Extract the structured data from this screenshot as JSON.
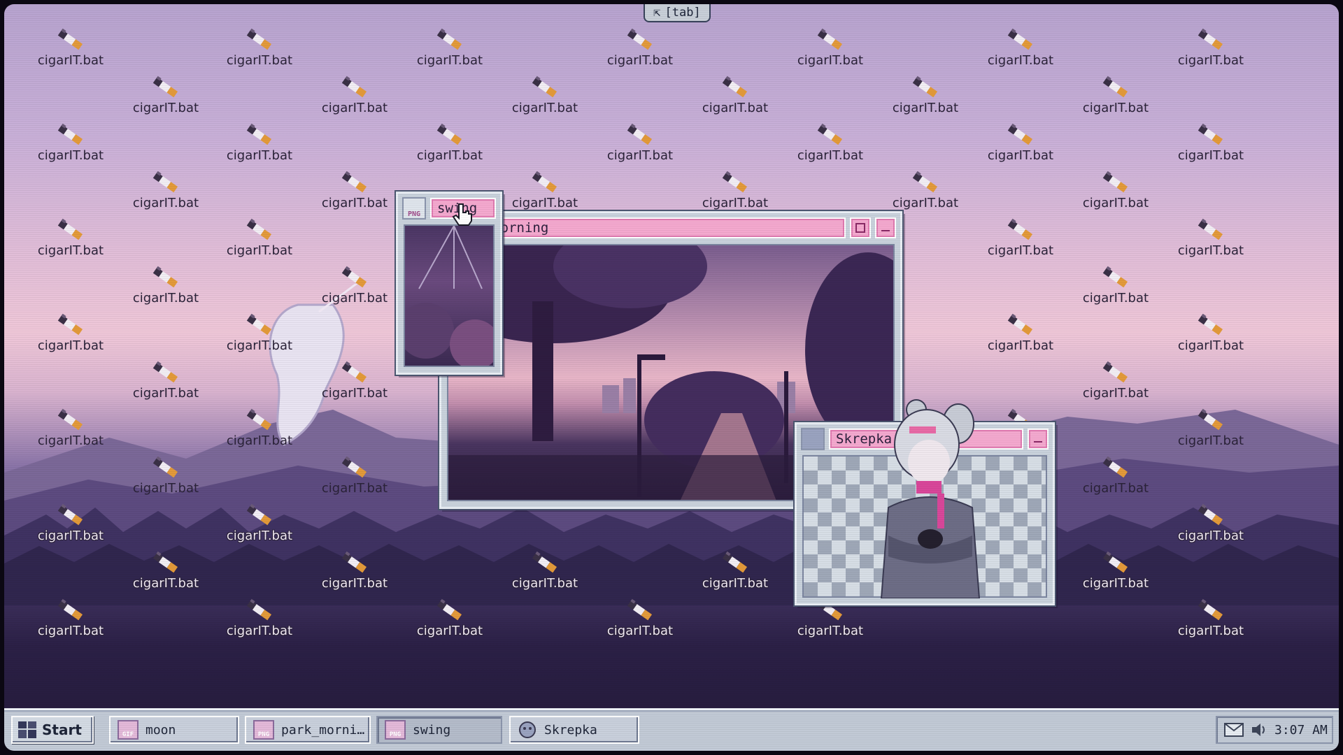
{
  "tab_hint": {
    "label": "[tab]"
  },
  "desktop": {
    "icon_name": "cigarette-icon",
    "icon_label": "cigarIT.bat"
  },
  "windows": {
    "swing": {
      "title": "swing",
      "file_badge": "PNG"
    },
    "park": {
      "title": "park_morning"
    },
    "skrepka": {
      "title": "Skrepka"
    }
  },
  "taskbar": {
    "start_label": "Start",
    "items": [
      {
        "label": "moon",
        "badge": "GIF"
      },
      {
        "label": "park_morni…",
        "badge": "PNG"
      },
      {
        "label": "swing",
        "badge": "PNG"
      },
      {
        "label": "Skrepka",
        "badge": ""
      }
    ],
    "clock": "3:07 AM"
  },
  "colors": {
    "accent_pink": "#f4a9cf",
    "window_frame": "#c9d2dc",
    "taskbar": "#c2cad6"
  }
}
